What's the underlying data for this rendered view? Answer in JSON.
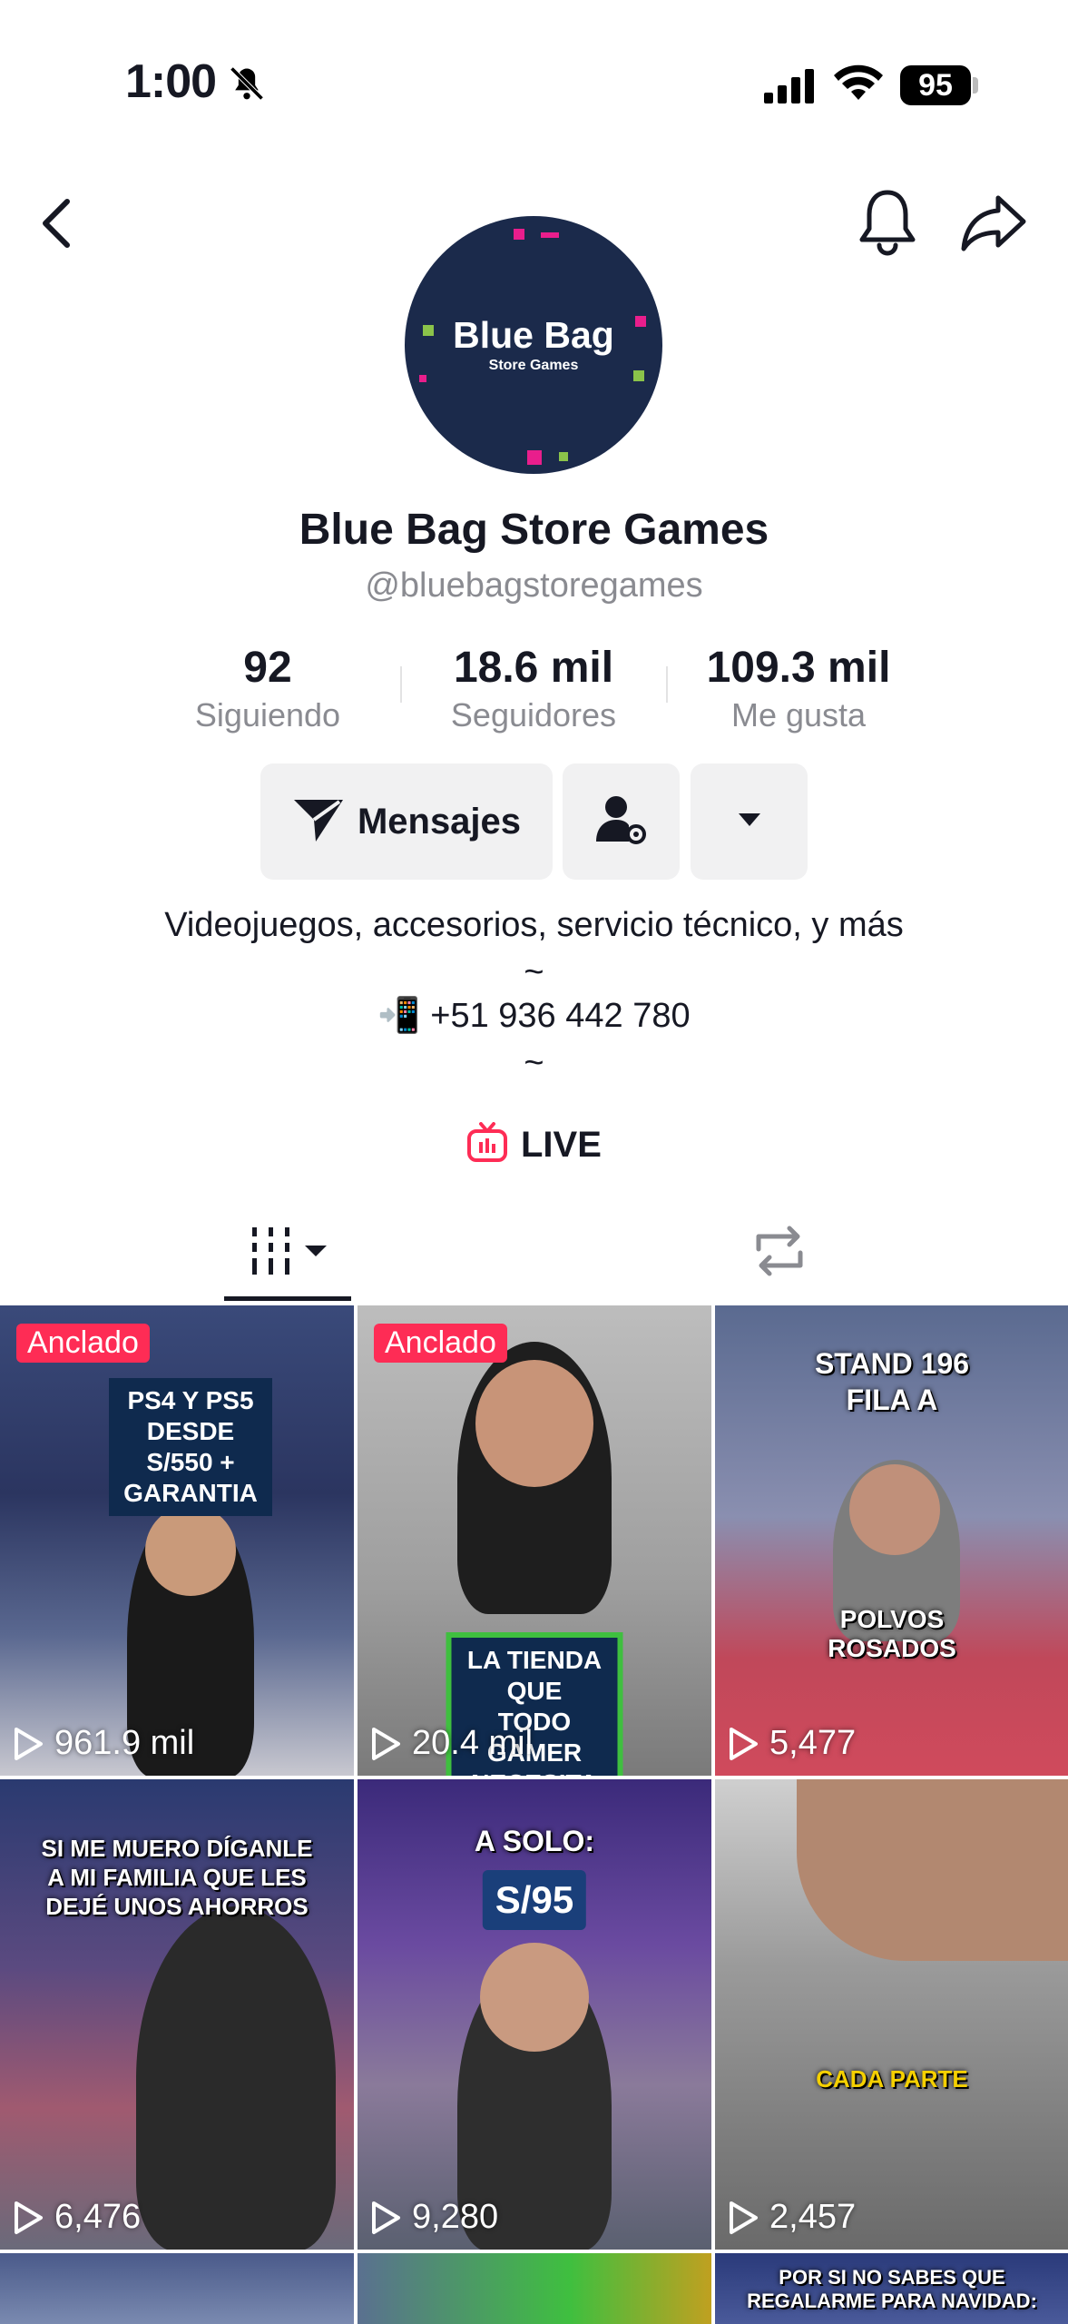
{
  "status": {
    "time": "1:00",
    "battery": "95"
  },
  "profile": {
    "avatar_title": "Blue Bag",
    "avatar_subtitle": "Store Games",
    "name": "Blue Bag Store Games",
    "handle": "@bluebagstoregames"
  },
  "stats": [
    {
      "value": "92",
      "label": "Siguiendo"
    },
    {
      "value": "18.6 mil",
      "label": "Seguidores"
    },
    {
      "value": "109.3 mil",
      "label": "Me gusta"
    }
  ],
  "actions": {
    "message_label": "Mensajes"
  },
  "bio": {
    "line1": "Videojuegos, accesorios, servicio técnico, y más",
    "sep1": "~",
    "phone": "📲 +51 936 442 780",
    "sep2": "~"
  },
  "live": {
    "label": "LIVE"
  },
  "icons": {
    "back": "back-arrow-icon",
    "bell": "bell-icon",
    "share": "share-icon",
    "message": "send-icon",
    "friend": "user-settings-icon",
    "more": "caret-down-icon",
    "live": "tv-icon",
    "grid": "videos-grid-icon",
    "repost": "repost-icon",
    "play": "play-icon"
  },
  "colors": {
    "accent": "#fe2c55",
    "text": "#161823",
    "muted": "#8a8b91",
    "button_bg": "#f1f1f2"
  },
  "videos": [
    {
      "pinned": "Anclado",
      "caption": "PS4 Y PS5\nDESDE S/550 +\nGARANTIA",
      "views": "961.9 mil"
    },
    {
      "pinned": "Anclado",
      "caption": "LA TIENDA QUE\nTODO GAMER\nNECESITA",
      "views": "20.4 mil"
    },
    {
      "caption_top": "STAND 196\nFILA A",
      "caption_bottom": "POLVOS\nROSADOS",
      "views": "5,477"
    },
    {
      "caption": "SI ME MUERO DÍGANLE\nA MI FAMILIA QUE LES\nDEJÉ UNOS AHORROS",
      "views": "6,476"
    },
    {
      "caption_top": "A SOLO:",
      "caption_bottom": "S/95",
      "views": "9,280"
    },
    {
      "caption": "CADA PARTE",
      "views": "2,457"
    },
    {
      "caption": ""
    },
    {
      "caption": ""
    },
    {
      "caption": "POR SI NO SABES QUE\nREGALARME PARA NAVIDAD:"
    }
  ]
}
